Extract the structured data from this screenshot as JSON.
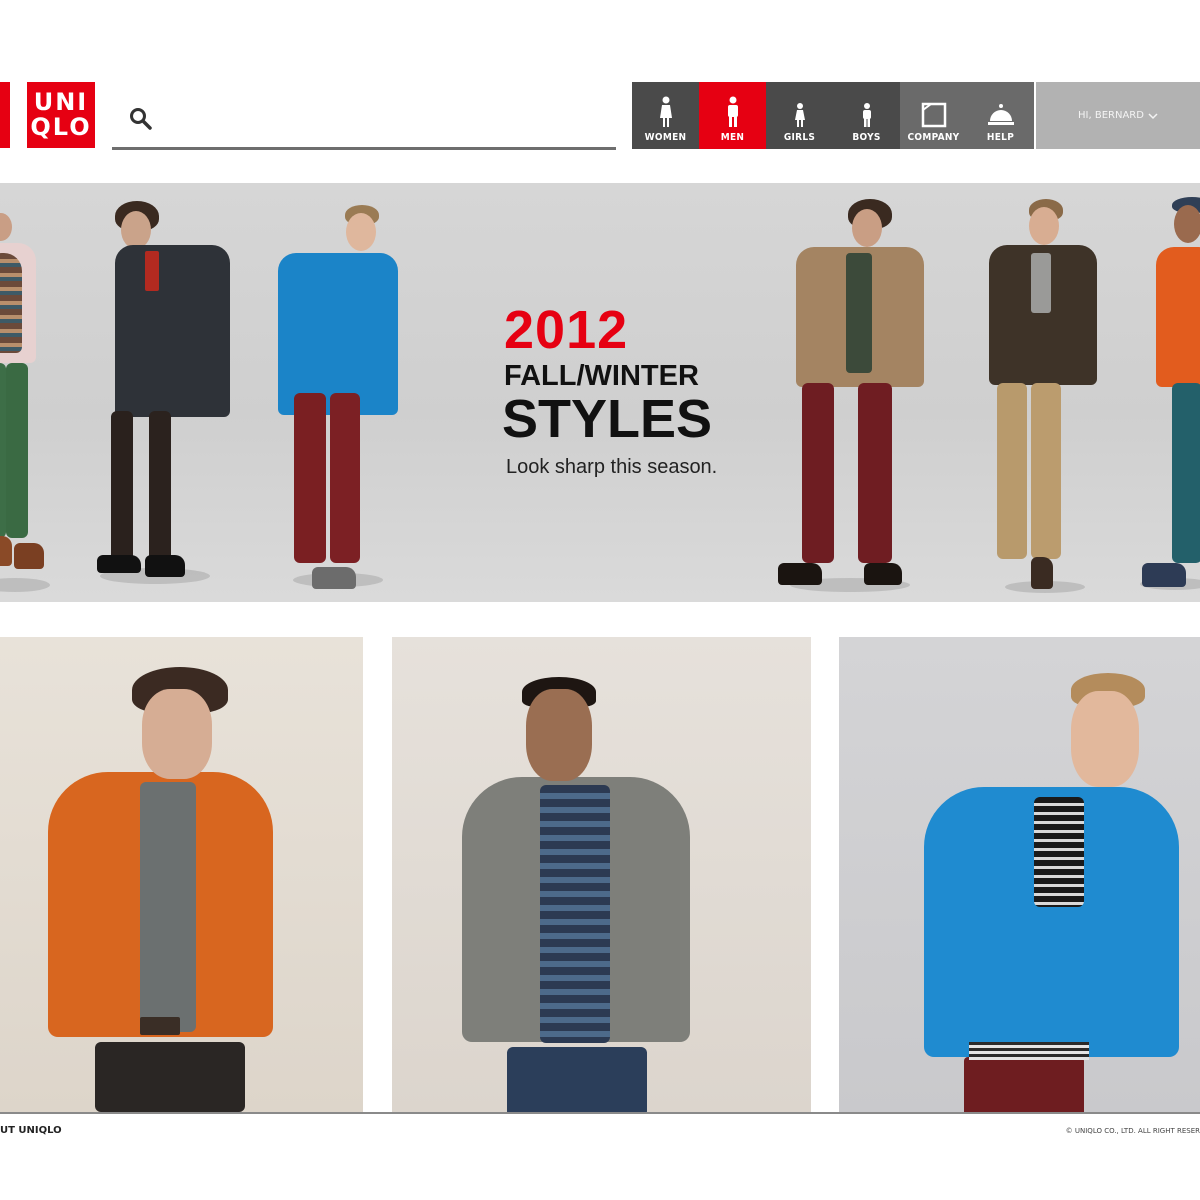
{
  "brand": {
    "logo_line1": "UNI",
    "logo_line2": "QLO",
    "color": "#e60012"
  },
  "search": {
    "icon": "search-icon",
    "placeholder": ""
  },
  "nav": {
    "items": [
      {
        "label": "WOMEN",
        "icon": "woman-icon",
        "bg": "#4a4a4a"
      },
      {
        "label": "MEN",
        "icon": "man-icon",
        "bg": "#e60012"
      },
      {
        "label": "GIRLS",
        "icon": "girl-icon",
        "bg": "#4a4a4a"
      },
      {
        "label": "BOYS",
        "icon": "boy-icon",
        "bg": "#4a4a4a"
      },
      {
        "label": "COMPANY",
        "icon": "company-icon",
        "bg": "#6a6a6a"
      },
      {
        "label": "HELP",
        "icon": "service-bell-icon",
        "bg": "#6a6a6a"
      }
    ],
    "user_greeting": "HI, BERNARD",
    "user_icon": "chevron-down-icon"
  },
  "hero": {
    "year": "2012",
    "season": "FALL/WINTER",
    "headline": "STYLES",
    "tagline": "Look sharp this season."
  },
  "tiles": [
    {
      "subject": "model in orange hooded sweatshirt"
    },
    {
      "subject": "model in grey windbreaker and striped tee"
    },
    {
      "subject": "model in blue fleece jacket"
    }
  ],
  "footer": {
    "left": "UT UNIQLO",
    "right": "© UNIQLO CO., LTD. ALL RIGHT RESER"
  }
}
